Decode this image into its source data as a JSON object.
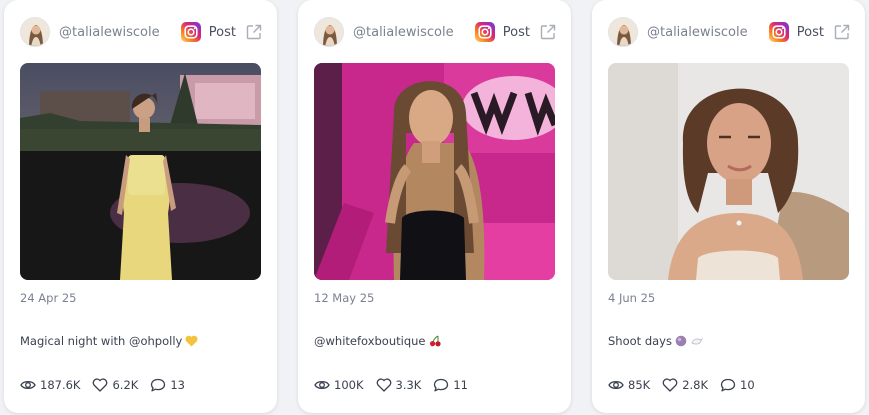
{
  "cards": [
    {
      "handle": "@talialewiscole",
      "platform_icon": "instagram-icon",
      "post_label": "Post",
      "open_icon": "external-link-icon",
      "date": "24 Apr 25",
      "caption": "Magical night with @ohpolly",
      "caption_emoji": "yellow-heart",
      "stats": {
        "views": "187.6K",
        "likes": "6.2K",
        "comments": "13"
      }
    },
    {
      "handle": "@talialewiscole",
      "platform_icon": "instagram-icon",
      "post_label": "Post",
      "open_icon": "external-link-icon",
      "date": "12 May 25",
      "caption": "@whitefoxboutique",
      "caption_emoji": "cherries",
      "stats": {
        "views": "100K",
        "likes": "3.3K",
        "comments": "11"
      }
    },
    {
      "handle": "@talialewiscole",
      "platform_icon": "instagram-icon",
      "post_label": "Post",
      "open_icon": "external-link-icon",
      "date": "4 Jun 25",
      "caption": "Shoot days",
      "caption_emoji": "purple-circle, white-bird",
      "stats": {
        "views": "85K",
        "likes": "2.8K",
        "comments": "10"
      }
    }
  ],
  "colors": {
    "card_bg": "#ffffff",
    "page_bg": "#f1f2f5",
    "muted_text": "#7b8191",
    "body_text": "#3b4150",
    "instagram_gradient": [
      "#feda75",
      "#fa7e1e",
      "#d62976",
      "#962fbf",
      "#4f5bd5"
    ]
  }
}
